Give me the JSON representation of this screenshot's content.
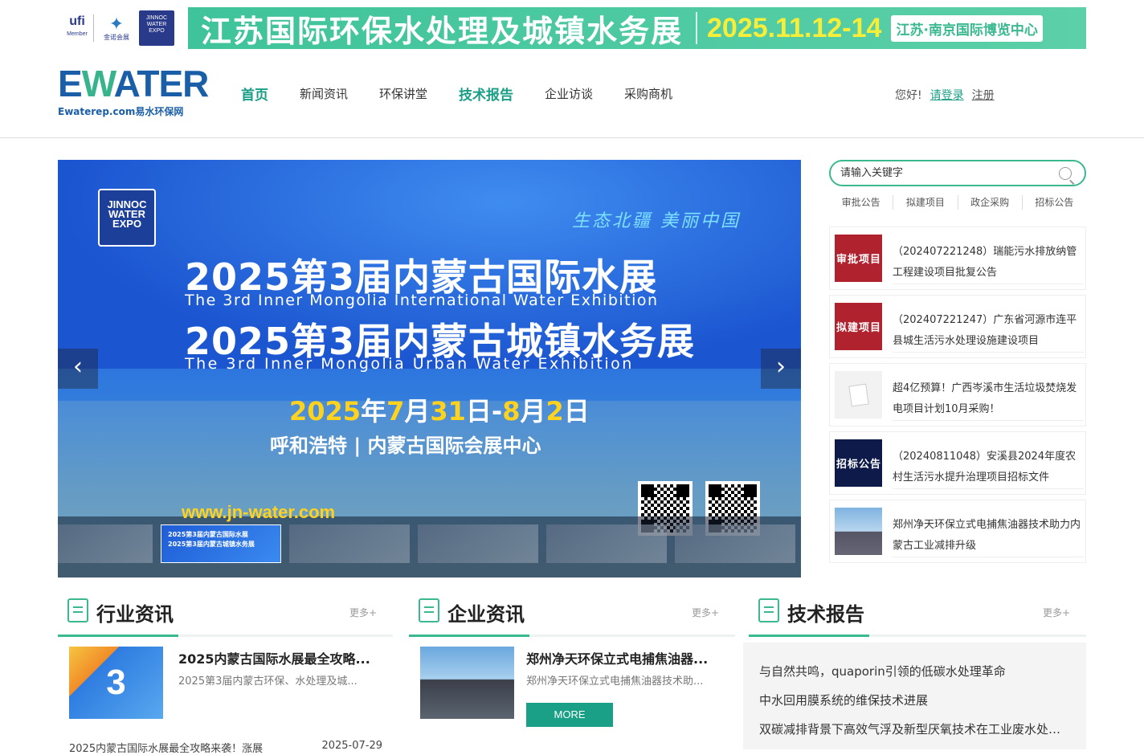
{
  "top_banner": {
    "logo_ufi": "ufi",
    "logo_ufi_sub": "Member",
    "logo_jinnuo": "金诺会展",
    "logo_jwe": "JINNOC WATER EXPO",
    "title": "江苏国际环保水处理及城镇水务展",
    "date": "2025.11.12-14",
    "venue": "江苏·南京国际博览中心"
  },
  "header": {
    "logo_main": "EWATER",
    "logo_sub": "Ewaterep.com易水环保网",
    "nav": [
      {
        "label": "首页"
      },
      {
        "label": "新闻资讯"
      },
      {
        "label": "环保讲堂"
      },
      {
        "label": "技术报告"
      },
      {
        "label": "企业访谈"
      },
      {
        "label": "采购商机"
      }
    ],
    "user": {
      "hello": "您好!",
      "login": "请登录",
      "register": "注册"
    }
  },
  "slider": {
    "logo": "JINNOC WATER EXPO",
    "slogan": "生态北疆 美丽中国",
    "headline1": "2025第3届内蒙古国际水展",
    "english1": "The 3rd Inner Mongolia International Water Exhibition",
    "headline2": "2025第3届内蒙古城镇水务展",
    "english2": "The 3rd Inner Mongolia Urban Water Exhibition",
    "date_parts": [
      "2025",
      "年",
      "7",
      "月",
      "31",
      "日-",
      "8",
      "月",
      "2",
      "日"
    ],
    "venue": "呼和浩特 | 内蒙古国际会展中心",
    "url": "www.jn-water.com",
    "active_thumb_text1": "2025第3届内蒙古国际水展",
    "active_thumb_text2": "2025第3届内蒙古城镇水务展",
    "prev_icon": "chevron-left-icon",
    "next_icon": "chevron-right-icon"
  },
  "search": {
    "placeholder": "请输入关键字",
    "tabs": [
      "审批公告",
      "拟建项目",
      "政企采购",
      "招标公告"
    ]
  },
  "side_news": [
    {
      "img_label": "审批项目",
      "text": "（202407221248）瑞能污水排放纳管工程建设项目批复公告"
    },
    {
      "img_label": "拟建项目",
      "text": "（202407221247）广东省河源市连平县城生活污水处理设施建设项目"
    },
    {
      "img_label": "",
      "text": "超4亿预算！广西岑溪市生活垃圾焚烧发电项目计划10月采购！"
    },
    {
      "img_label": "招标公告",
      "text": "（20240811048）安溪县2024年度农村生活污水提升治理项目招标文件"
    },
    {
      "img_label": "",
      "text": "郑州净天环保立式电捕焦油器技术助力内蒙古工业减排升级"
    }
  ],
  "sections": {
    "industry": {
      "title": "行业资讯",
      "more": "更多+",
      "article_title": "2025内蒙古国际水展最全攻略...",
      "article_desc": "2025第3届内蒙古环保、水处理及城...",
      "thumb_text": "3",
      "ticker_title": "2025内蒙古国际水展最全攻略来袭！涨展",
      "ticker_date": "2025-07-29"
    },
    "enterprise": {
      "title": "企业资讯",
      "more": "更多+",
      "article_title": "郑州净天环保立式电捕焦油器...",
      "article_desc": "郑州净天环保立式电捕焦油器技术助...",
      "more_button": "MORE"
    },
    "tech": {
      "title": "技术报告",
      "more": "更多+",
      "items": [
        "与自然共鸣，quaporin引领的低碳水处理革命",
        "中水回用膜系统的维保技术进展",
        "双碳减排背景下高效气浮及新型厌氧技术在工业废水处理中的应用"
      ]
    }
  },
  "colors": {
    "accent": "#3ab98f",
    "nav_active": "#1a9e86",
    "banner_yellow": "#f7ee3a"
  }
}
